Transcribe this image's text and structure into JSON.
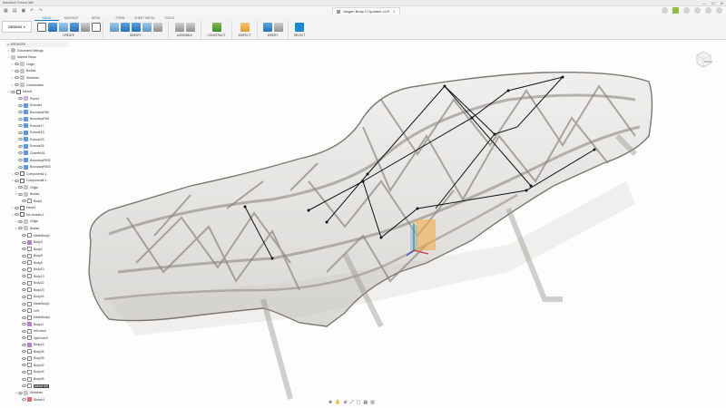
{
  "app": {
    "title": "Autodesk Fusion 360"
  },
  "window": {
    "minimize": "—",
    "maximize": "☐",
    "close": "✕"
  },
  "document": {
    "tab_title": "Vargen Body 2 Updated v24*"
  },
  "toolbar": {
    "workspace": "DESIGN",
    "tabs": [
      "SOLID",
      "SURFACE",
      "MESH",
      "FORM",
      "SHEET METAL",
      "TOOLS"
    ],
    "active_tab": "SOLID",
    "groups": {
      "create": "CREATE",
      "modify": "MODIFY",
      "assemble": "ASSEMBLE",
      "construct": "CONSTRUCT",
      "inspect": "INSPECT",
      "insert": "INSERT",
      "select": "SELECT"
    }
  },
  "browser": {
    "header": "BROWSER",
    "items": [
      {
        "label": "Document Settings",
        "icon": "gear-icon"
      },
      {
        "label": "Named Views",
        "icon": "folder-icon"
      },
      {
        "label": "Origin",
        "icon": "folder-icon"
      },
      {
        "label": "Bodies",
        "icon": "folder-icon"
      },
      {
        "label": "Sketches",
        "icon": "folder-icon"
      },
      {
        "label": "Construction",
        "icon": "folder-icon"
      },
      {
        "label": "Mirror1",
        "icon": "component-icon"
      },
      {
        "label": "Plane1",
        "icon": "plane-icon"
      },
      {
        "label": "Extrude1",
        "icon": "feature-icon"
      },
      {
        "label": "BoundaryFill6",
        "icon": "feature-icon"
      },
      {
        "label": "BoundaryFill8",
        "icon": "feature-icon"
      },
      {
        "label": "Extrude17",
        "icon": "feature-icon"
      },
      {
        "label": "Extrude18",
        "icon": "feature-icon"
      },
      {
        "label": "Extrude25",
        "icon": "feature-icon"
      },
      {
        "label": "Extrude26",
        "icon": "feature-icon"
      },
      {
        "label": "Chamfer31",
        "icon": "feature-icon"
      },
      {
        "label": "BoundaryFill32",
        "icon": "feature-icon"
      },
      {
        "label": "BoundaryFill33",
        "icon": "feature-icon"
      },
      {
        "label": "Component1:1",
        "icon": "component-icon"
      },
      {
        "label": "Component6:1",
        "icon": "component-icon"
      },
      {
        "label": "Origin",
        "icon": "folder-icon"
      },
      {
        "label": "Bodies",
        "icon": "folder-icon"
      },
      {
        "label": "Body1",
        "icon": "body-icon"
      },
      {
        "label": "frame1",
        "icon": "component-icon"
      },
      {
        "label": "foc chassis:1",
        "icon": "component-icon"
      },
      {
        "label": "Origin",
        "icon": "folder-icon"
      },
      {
        "label": "Bodies",
        "icon": "folder-icon"
      },
      {
        "label": "MeshBody2",
        "icon": "body-icon"
      },
      {
        "label": "Body3",
        "icon": "mesh-icon"
      },
      {
        "label": "Body4",
        "icon": "body-icon"
      },
      {
        "label": "Body5",
        "icon": "body-icon"
      },
      {
        "label": "Body8",
        "icon": "body-icon"
      },
      {
        "label": "Body10",
        "icon": "body-icon"
      },
      {
        "label": "Body13",
        "icon": "body-icon"
      },
      {
        "label": "Body22",
        "icon": "body-icon"
      },
      {
        "label": "Body23",
        "icon": "body-icon"
      },
      {
        "label": "Body24",
        "icon": "body-icon"
      },
      {
        "label": "MeshBody1",
        "icon": "body-icon"
      },
      {
        "label": "Left",
        "icon": "body-icon"
      },
      {
        "label": "MeshBody4",
        "icon": "body-icon"
      },
      {
        "label": "Body11",
        "icon": "mesh-icon"
      },
      {
        "label": "left mesh",
        "icon": "body-icon"
      },
      {
        "label": "right mesh",
        "icon": "body-icon"
      },
      {
        "label": "Body14",
        "icon": "mesh-icon"
      },
      {
        "label": "Body34",
        "icon": "body-icon"
      },
      {
        "label": "Body35",
        "icon": "body-icon"
      },
      {
        "label": "Body42",
        "icon": "body-icon"
      },
      {
        "label": "Body44",
        "icon": "body-icon"
      },
      {
        "label": "Body45",
        "icon": "body-icon"
      },
      {
        "label": "joined left",
        "icon": "body-icon",
        "selected": true
      },
      {
        "label": "Sketches",
        "icon": "folder-icon"
      },
      {
        "label": "Sketch1",
        "icon": "sketch-icon"
      }
    ]
  },
  "navbar": {
    "icons": [
      "orbit-icon",
      "pan-icon",
      "zoom-icon",
      "fit-icon",
      "display-icon",
      "grid-icon",
      "viewports-icon"
    ]
  }
}
